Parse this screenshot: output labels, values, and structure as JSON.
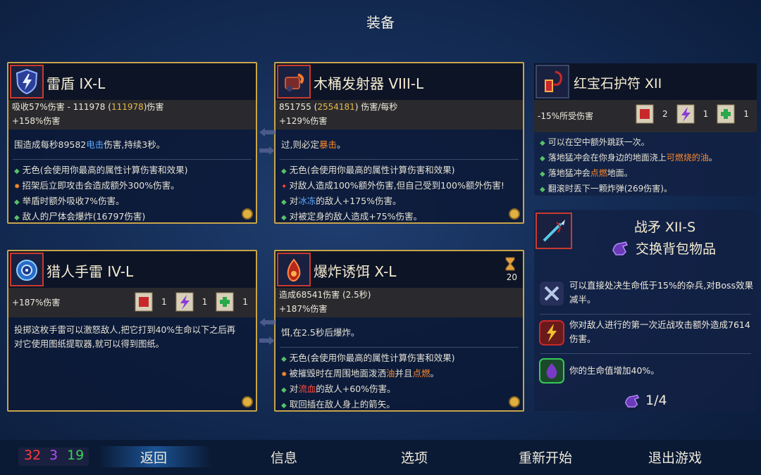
{
  "title": "装备",
  "cards": {
    "shield": {
      "name": "雷盾 IX-L",
      "stat1": "吸收57%伤害 - 111978 (",
      "stat1_gold": "111978",
      "stat1_end": ")伤害",
      "stat2": "+158%伤害",
      "desc1": "围造成每秒89582",
      "desc1_blue": "电击",
      "desc1_end": "伤害,持续3秒。",
      "b1": "无色(会使用你最高的属性计算伤害和效果)",
      "b2": "招架后立即攻击会造成额外300%伤害。",
      "b3": "举盾时额外吸收7%伤害。",
      "b4": "敌人的尸体会爆炸(16797伤害)"
    },
    "launcher": {
      "name": "木桶发射器 VIII-L",
      "stat1": "851755 (",
      "stat1_gold": "2554181",
      "stat1_end": ") 伤害/每秒",
      "stat2": "+129%伤害",
      "desc1": "过,则必定",
      "desc1_orange": "暴击",
      "desc1_end": "。",
      "b1": "无色(会使用你最高的属性计算伤害和效果)",
      "b2": "对敌人造成100%额外伤害,但自己受到100%额外伤害!",
      "b3a": "对",
      "b3_blue": "冰冻",
      "b3b": "的敌人+175%伤害。",
      "b4": "对被定身的敌人造成+75%伤害。"
    },
    "grenade": {
      "name": "猎人手雷 IV-L",
      "stat1": "+187%伤害",
      "s1": "1",
      "s2": "1",
      "s3": "1",
      "desc1": "投掷这枚手雷可以激怒敌人,把它打到40%生命以下之后再",
      "desc2": "对它使用图纸提取器,就可以得到图纸。"
    },
    "bait": {
      "name": "爆炸诱饵 X-L",
      "timer": "20",
      "stat1": "造成68541伤害 (2.5秒)",
      "stat2": "+187%伤害",
      "desc1": "饵,在2.5秒后爆炸。",
      "b1": "无色(会使用你最高的属性计算伤害和效果)",
      "b2a": "被摧毁时在周围地面泼洒",
      "b2_orange": "油",
      "b2b": "并且",
      "b2_orange2": "点燃",
      "b2c": "。",
      "b3a": "对",
      "b3_red": "流血",
      "b3b": "的敌人+60%伤害。",
      "b4": "取回插在敌人身上的箭矢。"
    }
  },
  "amulet": {
    "name": "红宝石护符 XII",
    "stat": "-15%所受伤害",
    "s1": "2",
    "s2": "1",
    "s3": "1",
    "b1": "可以在空中额外跳跃一次。",
    "b2a": "落地猛冲会在你身边的地面浇上",
    "b2_orange": "可燃烧的油",
    "b2b": "。",
    "b3a": "落地猛冲会",
    "b3_orange": "点燃",
    "b3b": "地面。",
    "b4": "翻滚时丢下一颗炸弹(269伤害)。"
  },
  "mutation": {
    "name": "战矛 XII-S",
    "swap": "交换背包物品",
    "m1": "可以直接处决生命低于15%的杂兵,对Boss效果减半。",
    "m2": "你对敌人进行的第一次近战攻击额外造成7614伤害。",
    "m3": "你的生命值增加40%。",
    "count": "1/4"
  },
  "stats": {
    "red": "32",
    "purple": "3",
    "green": "19"
  },
  "nav": {
    "back": "返回",
    "info": "信息",
    "options": "选项",
    "restart": "重新开始",
    "quit": "退出游戏"
  }
}
